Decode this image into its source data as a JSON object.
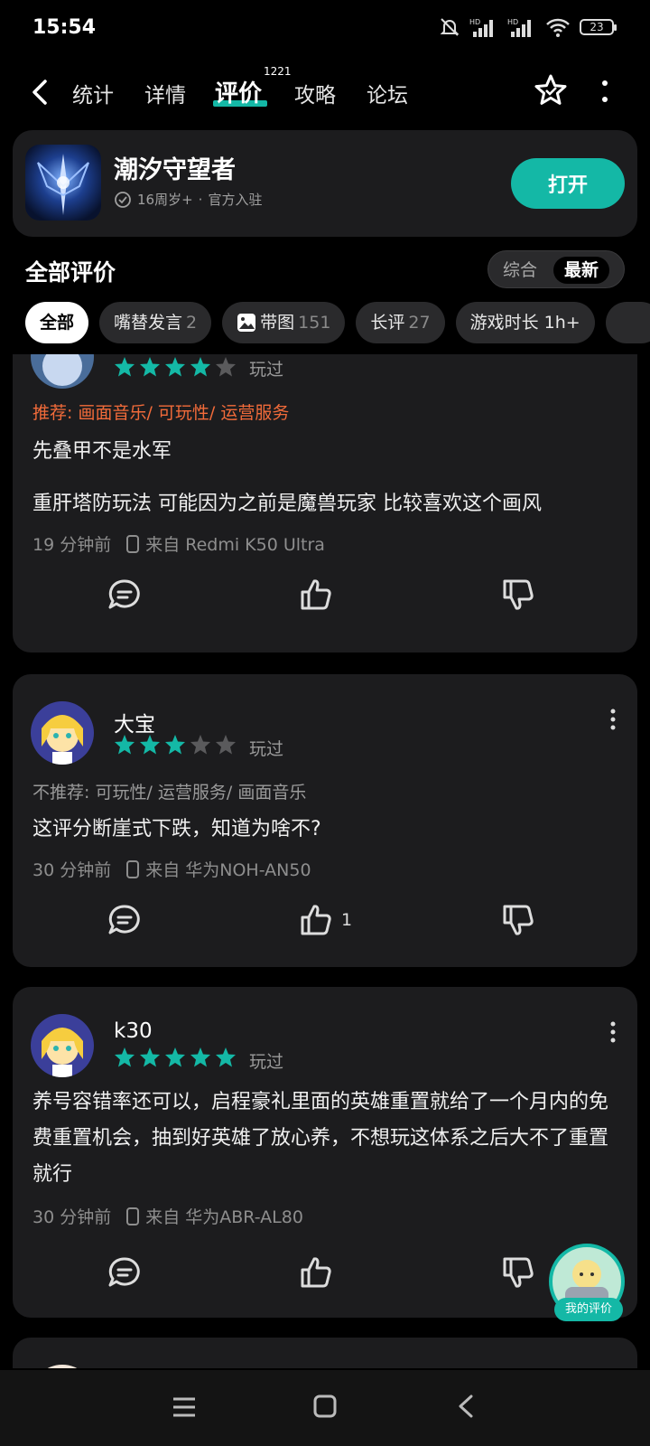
{
  "status_bar": {
    "time": "15:54",
    "battery": "23"
  },
  "nav": {
    "tabs": [
      {
        "label": "统计"
      },
      {
        "label": "详情"
      },
      {
        "label": "评价",
        "badge": "1221"
      },
      {
        "label": "攻略"
      },
      {
        "label": "论坛"
      }
    ]
  },
  "app": {
    "name": "潮汐守望者",
    "age_rating": "16周岁+",
    "separator": "·",
    "official": "官方入驻",
    "open_label": "打开"
  },
  "reviews_section": {
    "title": "全部评价",
    "sort": {
      "options": [
        "综合",
        "最新"
      ],
      "selected": "最新"
    },
    "filters": [
      {
        "label": "全部",
        "count": ""
      },
      {
        "label": "嘴替发言",
        "count": "2"
      },
      {
        "label": "带图",
        "count": "151"
      },
      {
        "label": "长评",
        "count": "27"
      },
      {
        "label": "游戏时长 1h+",
        "count": ""
      }
    ]
  },
  "reviews": [
    {
      "user": "",
      "rating": 4,
      "status": "玩过",
      "tag_prefix": "推荐: ",
      "tags": "画面音乐/ 可玩性/ 运营服务",
      "paragraphs": [
        "先叠甲不是水军",
        "重肝塔防玩法 可能因为之前是魔兽玩家 比较喜欢这个画风"
      ],
      "time": "19 分钟前",
      "device": "来自 Redmi K50 Ultra",
      "likes": ""
    },
    {
      "user": "大宝",
      "rating": 3,
      "status": "玩过",
      "tag_prefix": "不推荐: ",
      "tags": "可玩性/ 运营服务/ 画面音乐",
      "paragraphs": [
        "这评分断崖式下跌，知道为啥不?"
      ],
      "time": "30 分钟前",
      "device": "来自 华为NOH-AN50",
      "likes": "1"
    },
    {
      "user": "k30",
      "rating": 5,
      "status": "玩过",
      "tag_prefix": "",
      "tags": "",
      "paragraphs": [
        "养号容错率还可以，启程豪礼里面的英雄重置就给了一个月内的免费重置机会，抽到好英雄了放心养，不想玩这体系之后大不了重置就行"
      ],
      "time": "30 分钟前",
      "device": "来自 华为ABR-AL80",
      "likes": ""
    }
  ],
  "fab": {
    "label": "我的评价"
  },
  "colors": {
    "accent": "#14b8a6",
    "recommend": "#f26b3a",
    "card": "#1c1c1e"
  }
}
